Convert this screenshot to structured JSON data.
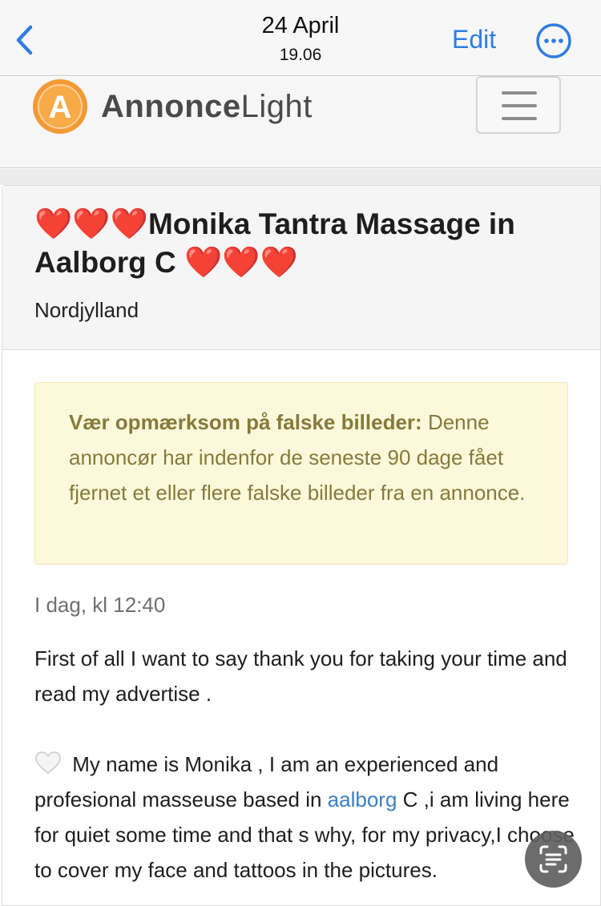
{
  "navbar": {
    "date": "24 April",
    "time": "19.06",
    "edit_label": "Edit",
    "back_icon": "chevron-left-icon",
    "more_icon": "ellipsis-circle-icon",
    "accent": "#2f7de1"
  },
  "site": {
    "logo_letter": "A",
    "logo_bold": "Annonce",
    "logo_light": "Light",
    "menu_icon": "hamburger-icon"
  },
  "ad": {
    "title_text_1": "Monika Tantra Massage in",
    "title_text_2": "Aalborg C",
    "heart_symbol": "❤️",
    "region": "Nordjylland",
    "warning_bold": "Vær opmærksom på falske billeder:",
    "warning_text": " Denne annoncør har indenfor de seneste 90 dage fået fjernet et eller flere falske billeder fra en annonce.",
    "timestamp": "I dag, kl 12:40",
    "paragraph_1": "First of all I want to say thank you for taking your time and read my advertise .",
    "paragraph_2_before": " My name is Monika , I am an experienced and profesional masseuse based in ",
    "paragraph_2_link": "aalborg",
    "paragraph_2_after": " C ,i am living here for quiet some time and that s why, for my privacy,I choose to cover my face and tattoos in the pictures.",
    "heart_color": "#d01f27",
    "warning_color": "#867a3b"
  },
  "overlay": {
    "scan_icon": "text-scan-icon"
  }
}
